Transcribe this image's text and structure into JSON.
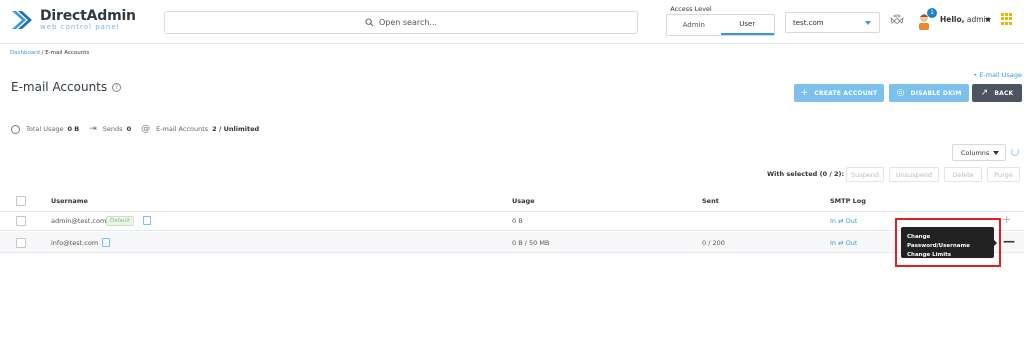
{
  "header": {
    "logo_title": "DirectAdmin",
    "logo_subtitle": "web control panel",
    "search_placeholder": "Open search...",
    "access_label": "Access Level",
    "access_options": [
      "Admin",
      "User"
    ],
    "access_selected": "User",
    "domain": "test.com",
    "notification_count": "1",
    "hello_prefix": "Hello,",
    "hello_user": "admin"
  },
  "breadcrumb": {
    "root": "Dashboard",
    "separator": " / ",
    "current": "E-mail Accounts"
  },
  "page": {
    "title": "E-mail Accounts",
    "help": "?",
    "email_usage_link": "• E-mail Usage"
  },
  "buttons": {
    "create": "CREATE ACCOUNT",
    "dkim": "DISABLE DKIM",
    "back": "BACK"
  },
  "stats": {
    "total_usage_label": "Total Usage",
    "total_usage_value": "0 B",
    "sends_label": "Sends",
    "sends_value": "0",
    "accounts_label": "E-mail Accounts",
    "accounts_value": "2 / Unlimited"
  },
  "toolbar": {
    "columns": "Columns",
    "with_selected": "With selected (0 / 2):",
    "actions": [
      "Suspend",
      "Unsuspend",
      "Delete",
      "Purge"
    ]
  },
  "table": {
    "headers": [
      "Username",
      "Usage",
      "Sent",
      "SMTP Log"
    ],
    "rows": [
      {
        "username": "admin@test.com",
        "tag": "Default",
        "usage": "0 B",
        "sent": "",
        "smtp_in": "In",
        "smtp_sep": " ⇄ ",
        "smtp_out": "Out"
      },
      {
        "username": "info@test.com",
        "tag": "",
        "usage": "0 B / 50 MB",
        "sent": "0 / 200",
        "smtp_in": "In",
        "smtp_sep": " ⇄ ",
        "smtp_out": "Out"
      }
    ]
  },
  "tooltip": {
    "line1": "Change Password/Username",
    "line2": "Change Limits"
  },
  "colors": {
    "accent": "#3a9ad9",
    "button_light": "#7cc0ee",
    "button_dark": "#4a5561",
    "highlight": "#e02020"
  }
}
